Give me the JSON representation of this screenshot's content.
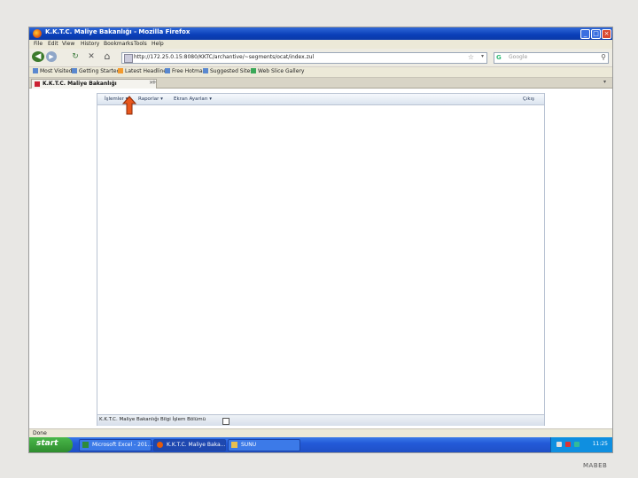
{
  "window": {
    "title": "K.K.T.C. Maliye Bakanlığı - Mozilla Firefox",
    "min": "_",
    "max": "□",
    "close": "×"
  },
  "menu": [
    "File",
    "Edit",
    "View",
    "History",
    "Bookmarks",
    "Tools",
    "Help"
  ],
  "nav": {
    "url": "http://172.25.0.15:8080/KKTC/archantive/~segments/ocat/index.zul",
    "search_placeholder": "Google",
    "back_glyph": "◀",
    "forward_glyph": "▶",
    "reload_glyph": "↻",
    "stop_glyph": "✕",
    "home_glyph": "⌂"
  },
  "bookmarks": [
    "Most Visited",
    "Getting Started",
    "Latest Headlines",
    "Free Hotmail",
    "Suggested Sites",
    "Web Slice Gallery"
  ],
  "tab": {
    "label": "K.K.T.C. Maliye Bakanlığı",
    "new_tab": "+"
  },
  "app": {
    "menu": [
      "İşlemler ▾",
      "Raporlar ▾",
      "Ekran Ayarları ▾"
    ],
    "logout": "Çıkış",
    "footer": "K.K.T.C. Maliye Bakanlığı Bilgi İşlem Bölümü"
  },
  "status": "Done",
  "taskbar": {
    "start": "start",
    "tasks": [
      "Microsoft Excel - 201...",
      "K.K.T.C. Maliye Baka...",
      "SUNU"
    ],
    "clock": "11:25"
  },
  "slide_footer": "MABEB",
  "colors": {
    "accent_arrow": "#e8561c",
    "titlebar": "#0a3fb8",
    "taskbar": "#235ad8"
  }
}
